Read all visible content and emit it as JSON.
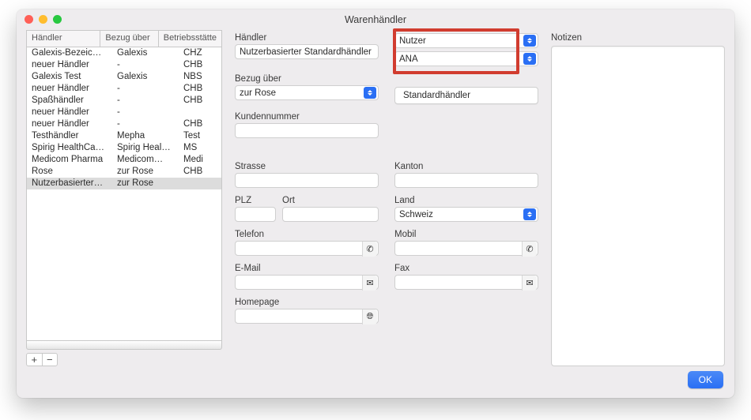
{
  "window": {
    "title": "Warenhändler"
  },
  "list": {
    "headers": {
      "handler": "Händler",
      "bezug": "Bezug über",
      "betrieb": "Betriebsstätte"
    },
    "rows": [
      {
        "handler": "Galexis-Bezeic…",
        "bezug": "Galexis",
        "betrieb": "CHZ"
      },
      {
        "handler": "neuer Händler",
        "bezug": "-",
        "betrieb": "CHB"
      },
      {
        "handler": "Galexis Test",
        "bezug": "Galexis",
        "betrieb": "NBS"
      },
      {
        "handler": "neuer Händler",
        "bezug": "-",
        "betrieb": "CHB"
      },
      {
        "handler": "Spaßhändler",
        "bezug": "-",
        "betrieb": "CHB"
      },
      {
        "handler": "neuer Händler",
        "bezug": "-",
        "betrieb": ""
      },
      {
        "handler": "neuer Händler",
        "bezug": "-",
        "betrieb": "CHB"
      },
      {
        "handler": "Testhändler",
        "bezug": "Mepha",
        "betrieb": "Test"
      },
      {
        "handler": "Spirig HealthCa…",
        "bezug": "Spirig Heal…",
        "betrieb": "MS"
      },
      {
        "handler": "Medicom Pharma",
        "bezug": "Medicom…",
        "betrieb": "Medi"
      },
      {
        "handler": "Rose",
        "bezug": "zur Rose",
        "betrieb": "CHB"
      },
      {
        "handler": "Nutzerbasierter…",
        "bezug": "zur Rose",
        "betrieb": ""
      }
    ],
    "selected_index": 11,
    "add_label": "+",
    "remove_label": "−"
  },
  "form": {
    "handler_label": "Händler",
    "handler_value": "Nutzerbasierter Standardhändler",
    "scope_label": "Nutzer",
    "scope_value": "ANA",
    "bezug_label": "Bezug über",
    "bezug_value": "zur Rose",
    "standard_btn": "Standardhändler",
    "kundennr_label": "Kundennummer",
    "kundennr_value": "",
    "strasse_label": "Strasse",
    "strasse_value": "",
    "kanton_label": "Kanton",
    "kanton_value": "",
    "plz_label": "PLZ",
    "plz_value": "",
    "ort_label": "Ort",
    "ort_value": "",
    "land_label": "Land",
    "land_value": "Schweiz",
    "telefon_label": "Telefon",
    "telefon_value": "",
    "mobil_label": "Mobil",
    "mobil_value": "",
    "email_label": "E-Mail",
    "email_value": "",
    "fax_label": "Fax",
    "fax_value": "",
    "homepage_label": "Homepage",
    "homepage_value": "",
    "icons": {
      "phone": "phone-icon",
      "mail": "envelope-icon",
      "globe": "globe-icon"
    }
  },
  "notes": {
    "label": "Notizen"
  },
  "footer": {
    "ok": "OK"
  }
}
